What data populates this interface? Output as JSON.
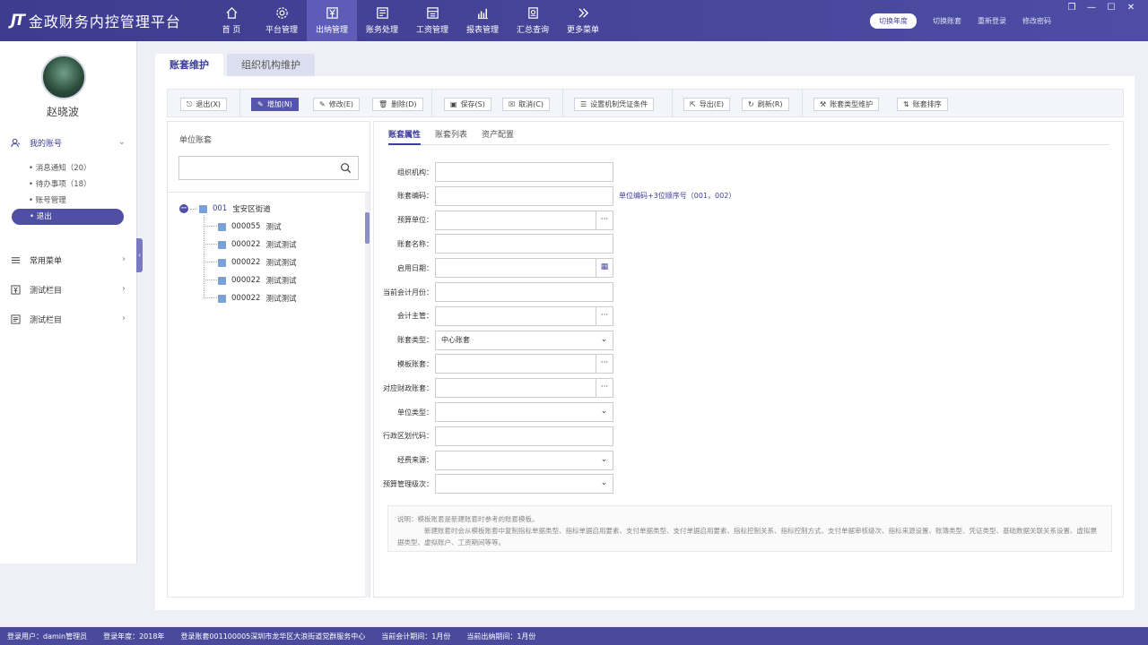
{
  "app": {
    "logo_mark": "JT",
    "title": "金政财务内控管理平台"
  },
  "nav": [
    {
      "label": "首 页",
      "icon": "home-icon"
    },
    {
      "label": "平台管理",
      "icon": "gear-icon"
    },
    {
      "label": "出纳管理",
      "icon": "yen-icon",
      "active": true
    },
    {
      "label": "账务处理",
      "icon": "ledger-icon"
    },
    {
      "label": "工资管理",
      "icon": "salary-icon"
    },
    {
      "label": "报表管理",
      "icon": "chart-icon"
    },
    {
      "label": "汇总查询",
      "icon": "summary-icon"
    },
    {
      "label": "更多菜单",
      "icon": "double-chevron-icon"
    }
  ],
  "header_actions": {
    "switch_year": "切换年度",
    "switch_book": "切换账套",
    "relogin": "重新登录",
    "change_password": "修改密码"
  },
  "window_controls": {
    "restore": "❐",
    "minimize": "—",
    "maximize": "☐",
    "close": "✕"
  },
  "user": {
    "name": "赵晓波"
  },
  "sidebar": {
    "my_account": "我的账号",
    "my_account_items": [
      "消息通知（20）",
      "待办事项（18）",
      "账号管理"
    ],
    "exit": "退出",
    "common_menu": "常用菜单",
    "test_col_1": "测试栏目",
    "test_col_2": "测试栏目",
    "collapse_glyph": "‹"
  },
  "page_tabs": [
    "账套维护",
    "组织机构维护"
  ],
  "toolbar": {
    "exit": "退出(X)",
    "add": "增加(N)",
    "edit": "修改(E)",
    "delete": "删除(D)",
    "save": "保存(S)",
    "cancel": "取消(C)",
    "set_voucher": "设置机制凭证条件",
    "export": "导出(E)",
    "refresh": "刷新(R)",
    "book_type": "账套类型维护",
    "book_sort": "账套排序"
  },
  "left_panel": {
    "title": "单位账套",
    "search_value": ""
  },
  "tree": {
    "root": {
      "code": "001",
      "name": "宝安区街道"
    },
    "children": [
      {
        "code": "000055",
        "name": "测试"
      },
      {
        "code": "000022",
        "name": "测试测试"
      },
      {
        "code": "000022",
        "name": "测试测试"
      },
      {
        "code": "000022",
        "name": "测试测试"
      },
      {
        "code": "000022",
        "name": "测试测试"
      }
    ]
  },
  "right_tabs": [
    "账套属性",
    "账套列表",
    "资产配置"
  ],
  "form": [
    {
      "label": "组织机构：",
      "value": "",
      "suffix": ""
    },
    {
      "label": "账套编码：",
      "value": "",
      "suffix": "",
      "hint": "单位编码+3位顺序号（001，002）"
    },
    {
      "label": "预算单位：",
      "value": "",
      "suffix": "···"
    },
    {
      "label": "账套名称：",
      "value": "",
      "suffix": ""
    },
    {
      "label": "启用日期：",
      "value": "",
      "suffix": "calendar"
    },
    {
      "label": "当前会计月份：",
      "value": "",
      "suffix": ""
    },
    {
      "label": "会计主管：",
      "value": "",
      "suffix": "···"
    },
    {
      "label": "账套类型：",
      "value": "中心账套",
      "suffix": "chevron"
    },
    {
      "label": "模板账套：",
      "value": "",
      "suffix": "···"
    },
    {
      "label": "对应财政账套：",
      "value": "",
      "suffix": "···"
    },
    {
      "label": "单位类型：",
      "value": "",
      "suffix": "chevron"
    },
    {
      "label": "行政区划代码：",
      "value": "",
      "suffix": ""
    },
    {
      "label": "经费来源：",
      "value": "",
      "suffix": "chevron"
    },
    {
      "label": "预算管理级次：",
      "value": "",
      "suffix": "chevron"
    }
  ],
  "note": {
    "line1": "说明：模板账套是新建账套时参考的账套模板。",
    "line2": "新建账套时会从模板账套中复制指标单据类型、指标单据启用要素、支付单据类型、支付单据启用要素、指标控制关系、指标控制方式、支付单据审核级次、指标来源设置、账簿类型、凭证类型、基础数据关联关系设置、虚拟票据类型、虚拟账户、工资期间等等。"
  },
  "status": {
    "user": "登录用户：damin管理员",
    "year": "登录年度：2018年",
    "book": "登录账套001100005深圳市龙华区大浪街道党群服务中心",
    "acct_period": "当前会计期间：1月份",
    "cashier_period": "当前出纳期间：1月份"
  }
}
